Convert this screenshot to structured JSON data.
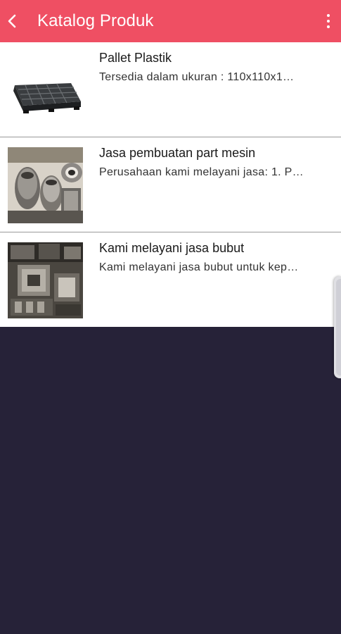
{
  "appbar": {
    "title": "Katalog Produk",
    "back_icon": "chevron-left-icon",
    "menu_icon": "more-vert-icon",
    "color": "#ef4f63"
  },
  "products": [
    {
      "title": "Pallet Plastik",
      "description": "Tersedia dalam ukuran : 110x110x1…",
      "image": "pallet-image"
    },
    {
      "title": "Jasa pembuatan part mesin",
      "description": "Perusahaan kami melayani jasa: 1. P…",
      "image": "machine-parts-image"
    },
    {
      "title": "Kami melayani jasa bubut",
      "description": "Kami melayani jasa bubut untuk kep…",
      "image": "lathe-work-image"
    }
  ],
  "background_color": "#262238"
}
